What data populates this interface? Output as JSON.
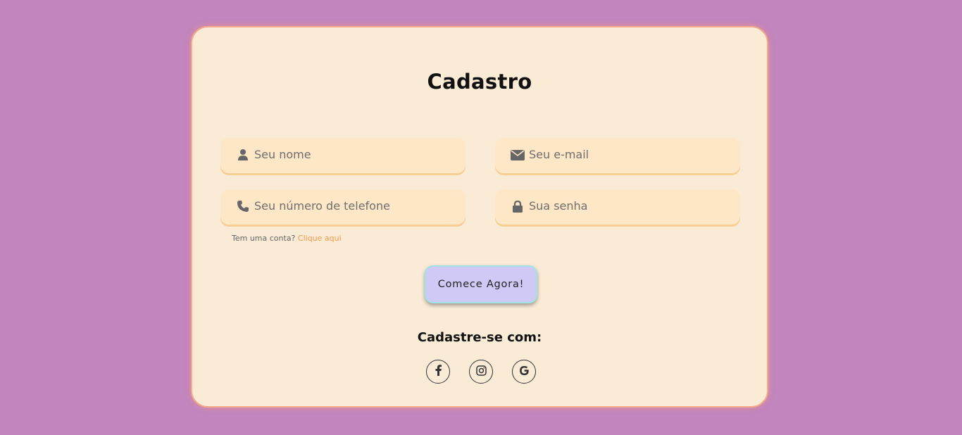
{
  "form": {
    "title": "Cadastro",
    "fields": {
      "name": {
        "placeholder": "Seu nome",
        "icon": "user-icon"
      },
      "email": {
        "placeholder": "Seu e-mail",
        "icon": "envelope-icon"
      },
      "phone": {
        "placeholder": "Seu número de telefone",
        "icon": "phone-icon"
      },
      "password": {
        "placeholder": "Sua senha",
        "icon": "lock-icon"
      }
    },
    "login_prompt": "Tem uma conta?",
    "login_link": "Clique aqui",
    "submit_label": "Comece Agora!"
  },
  "social": {
    "title": "Cadastre-se com:",
    "providers": [
      "facebook-icon",
      "instagram-icon",
      "google-icon"
    ]
  },
  "colors": {
    "background": "#c285bd",
    "card": "#faebd7",
    "card_border": "#f2a98c",
    "field": "#fee7c6",
    "link": "#f29a4a",
    "button": "#d0c8f5",
    "button_border": "#9fe3e8"
  }
}
